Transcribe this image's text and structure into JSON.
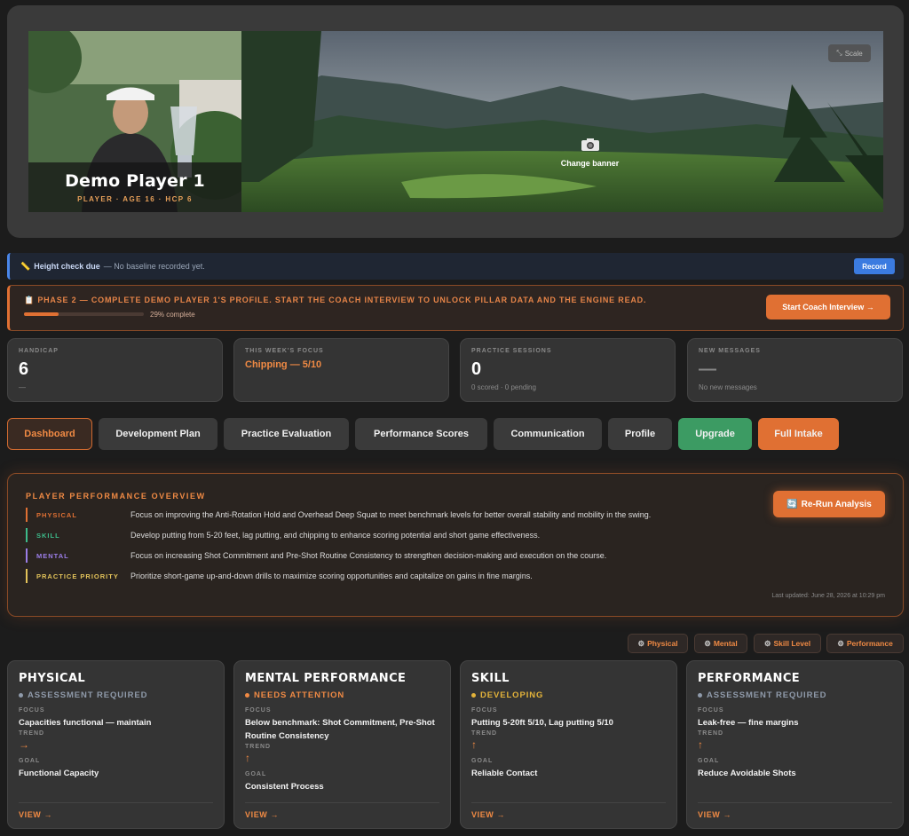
{
  "banner": {
    "player_name": "Demo Player 1",
    "player_meta": "PLAYER · AGE 16 · HCP 6",
    "scale_label": "Scale",
    "change_banner_label": "Change banner"
  },
  "height_check": {
    "title": "Height check due",
    "text": "— No baseline recorded yet.",
    "record_label": "Record"
  },
  "phase": {
    "text": "PHASE 2 — COMPLETE DEMO PLAYER 1'S PROFILE. START THE COACH INTERVIEW TO UNLOCK PILLAR DATA AND THE ENGINE READ.",
    "progress_percent": 29,
    "progress_label": "29% complete",
    "button_label": "Start Coach Interview →"
  },
  "stats": [
    {
      "label": "HANDICAP",
      "value": "6",
      "sub": "—"
    },
    {
      "label": "THIS WEEK'S FOCUS",
      "value": "Chipping — 5/10",
      "sub": ""
    },
    {
      "label": "PRACTICE SESSIONS",
      "value": "0",
      "sub": "0 scored · 0 pending"
    },
    {
      "label": "NEW MESSAGES",
      "value": "—",
      "sub": "No new messages"
    }
  ],
  "tabs": [
    {
      "label": "Dashboard"
    },
    {
      "label": "Development Plan"
    },
    {
      "label": "Practice Evaluation"
    },
    {
      "label": "Performance Scores"
    },
    {
      "label": "Communication"
    },
    {
      "label": "Profile"
    },
    {
      "label": "Upgrade"
    },
    {
      "label": "Full Intake"
    }
  ],
  "overview": {
    "title": "PLAYER PERFORMANCE OVERVIEW",
    "rerun_label": "Re-Run Analysis",
    "rows": [
      {
        "tag": "PHYSICAL",
        "desc": "Focus on improving the Anti-Rotation Hold and Overhead Deep Squat to meet benchmark levels for better overall stability and mobility in the swing.",
        "color": "#e07033"
      },
      {
        "tag": "SKILL",
        "desc": "Develop putting from 5-20 feet, lag putting, and chipping to enhance scoring potential and short game effectiveness.",
        "color": "#3dbb8a"
      },
      {
        "tag": "MENTAL",
        "desc": "Focus on increasing Shot Commitment and Pre-Shot Routine Consistency to strengthen decision-making and execution on the course.",
        "color": "#9b7ee8"
      },
      {
        "tag": "PRACTICE PRIORITY",
        "desc": "Prioritize short-game up-and-down drills to maximize scoring opportunities and capitalize on gains in fine margins.",
        "color": "#e3c35a"
      }
    ],
    "updated": "Last updated: June 28, 2026 at 10:29 pm"
  },
  "filters": [
    {
      "label": "Physical"
    },
    {
      "label": "Mental"
    },
    {
      "label": "Skill Level"
    },
    {
      "label": "Performance"
    }
  ],
  "pillars": [
    {
      "title": "PHYSICAL",
      "status": "ASSESSMENT REQUIRED",
      "status_color": "#8f9aaa",
      "focus_label": "FOCUS",
      "focus": "Capacities functional — maintain",
      "trend_label": "TREND",
      "trend": "→",
      "goal_label": "GOAL",
      "goal": "Functional Capacity",
      "view": "VIEW →"
    },
    {
      "title": "MENTAL PERFORMANCE",
      "status": "NEEDS ATTENTION",
      "status_color": "#f08a44",
      "focus_label": "FOCUS",
      "focus": "Below benchmark: Shot Commitment, Pre-Shot Routine Consistency",
      "trend_label": "TREND",
      "trend": "↑",
      "goal_label": "GOAL",
      "goal": "Consistent Process",
      "view": "VIEW →"
    },
    {
      "title": "SKILL",
      "status": "DEVELOPING",
      "status_color": "#e3b33a",
      "focus_label": "FOCUS",
      "focus": "Putting 5-20ft 5/10, Lag putting 5/10",
      "trend_label": "TREND",
      "trend": "↑",
      "goal_label": "GOAL",
      "goal": "Reliable Contact",
      "view": "VIEW →"
    },
    {
      "title": "PERFORMANCE",
      "status": "ASSESSMENT REQUIRED",
      "status_color": "#8f9aaa",
      "focus_label": "FOCUS",
      "focus": "Leak-free — fine margins",
      "trend_label": "TREND",
      "trend": "↑",
      "goal_label": "GOAL",
      "goal": "Reduce Avoidable Shots",
      "view": "VIEW →"
    }
  ]
}
